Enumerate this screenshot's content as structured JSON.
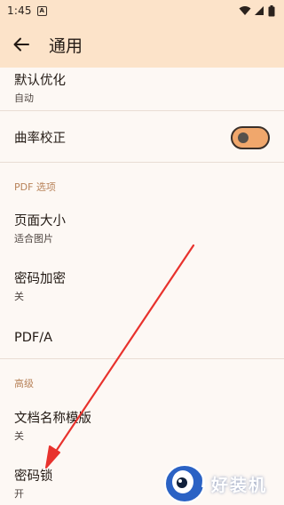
{
  "status_bar": {
    "time": "1:45",
    "notification_badge": "A",
    "icons": [
      "wifi-icon",
      "signal-icon",
      "battery-icon"
    ]
  },
  "app_bar": {
    "back_icon": "arrow-left-icon",
    "title": "通用"
  },
  "settings": {
    "default_optimize": {
      "title": "默认优化",
      "subtitle": "自动"
    },
    "curve_correction": {
      "title": "曲率校正",
      "toggle_on": true
    },
    "pdf_section": {
      "header": "PDF 选项"
    },
    "page_size": {
      "title": "页面大小",
      "subtitle": "适合图片"
    },
    "password_encrypt": {
      "title": "密码加密",
      "subtitle": "关"
    },
    "pdfa": {
      "title": "PDF/A"
    },
    "advanced_section": {
      "header": "高级"
    },
    "doc_name_template": {
      "title": "文档名称模版",
      "subtitle": "关"
    },
    "password_lock": {
      "title": "密码锁",
      "subtitle": "开"
    }
  },
  "watermark": {
    "text": "好装机"
  },
  "colors": {
    "app_bar_bg": "#fce3c9",
    "page_bg": "#fdf8f4",
    "section_header": "#b8835a",
    "toggle_track": "#f0a76c",
    "annotation_arrow": "#e8322d"
  }
}
